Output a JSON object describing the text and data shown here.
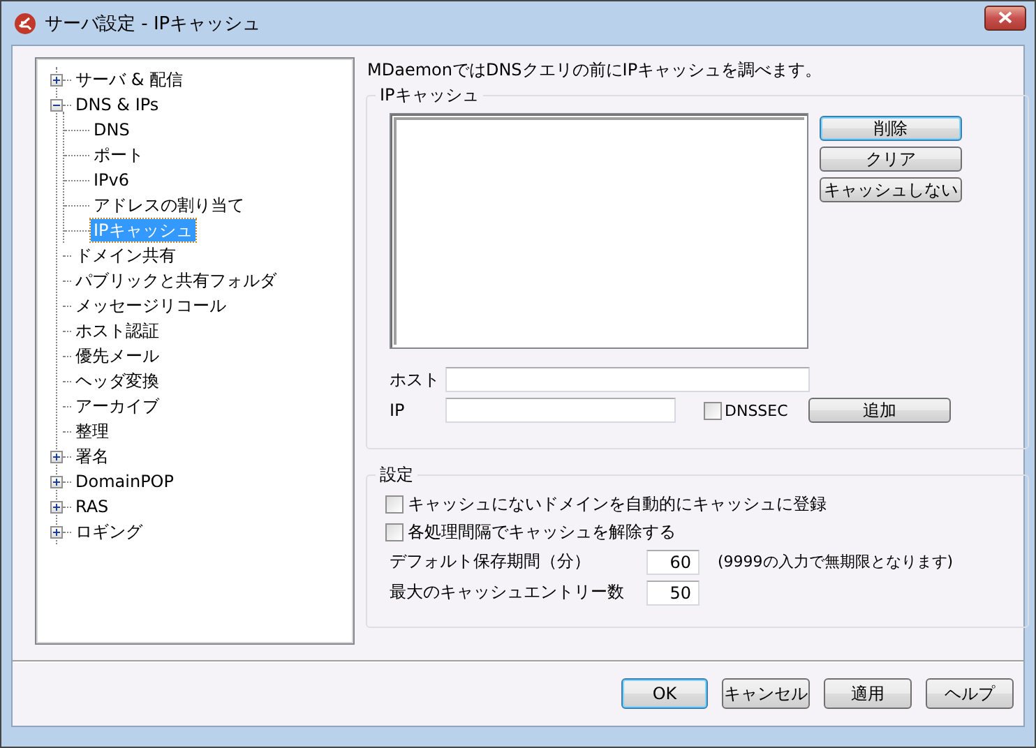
{
  "window": {
    "title": "サーバ設定 - IPキャッシュ"
  },
  "tree": [
    {
      "label": "サーバ & 配信",
      "expanded": false,
      "selected": false
    },
    {
      "label": "DNS & IPs",
      "expanded": true,
      "selected": false,
      "children": [
        {
          "label": "DNS",
          "selected": false
        },
        {
          "label": "ポート",
          "selected": false
        },
        {
          "label": "IPv6",
          "selected": false
        },
        {
          "label": "アドレスの割り当て",
          "selected": false
        },
        {
          "label": "IPキャッシュ",
          "selected": true
        }
      ]
    },
    {
      "label": "ドメイン共有",
      "selected": false
    },
    {
      "label": "パブリックと共有フォルダ",
      "selected": false
    },
    {
      "label": "メッセージリコール",
      "selected": false
    },
    {
      "label": "ホスト認証",
      "selected": false
    },
    {
      "label": "優先メール",
      "selected": false
    },
    {
      "label": "ヘッダ変換",
      "selected": false
    },
    {
      "label": "アーカイブ",
      "selected": false
    },
    {
      "label": "整理",
      "selected": false
    },
    {
      "label": "署名",
      "expanded": false,
      "selected": false
    },
    {
      "label": "DomainPOP",
      "expanded": false,
      "selected": false
    },
    {
      "label": "RAS",
      "expanded": false,
      "selected": false
    },
    {
      "label": "ロギング",
      "expanded": false,
      "selected": false
    }
  ],
  "description": "MDaemonではDNSクエリの前にIPキャッシュを調べます。",
  "ip_cache": {
    "title": "IPキャッシュ",
    "buttons": [
      {
        "label": "削除",
        "default": true
      },
      {
        "label": "クリア",
        "default": false
      },
      {
        "label": "キャッシュしない",
        "default": false
      }
    ],
    "host_label": "ホスト",
    "ip_label": "IP",
    "dnssec": {
      "label": "DNSSEC",
      "checked": false
    },
    "add_button": "追加"
  },
  "settings": {
    "title": "設定",
    "checkboxes": [
      {
        "label": "キャッシュにないドメインを自動的にキャッシュに登録",
        "checked": false
      },
      {
        "label": "各処理間隔でキャッシュを解除する",
        "checked": false
      }
    ],
    "fields": [
      {
        "label": "デフォルト保存期間（分）",
        "value": "60",
        "note": "(9999の入力で無期限となります)"
      },
      {
        "label": "最大のキャッシュエントリー数",
        "value": "50"
      }
    ]
  },
  "buttons": [
    {
      "label": "OK",
      "default": true
    },
    {
      "label": "キャンセル",
      "default": false
    },
    {
      "label": "適用",
      "default": false
    },
    {
      "label": "ヘルプ",
      "default": false
    }
  ]
}
